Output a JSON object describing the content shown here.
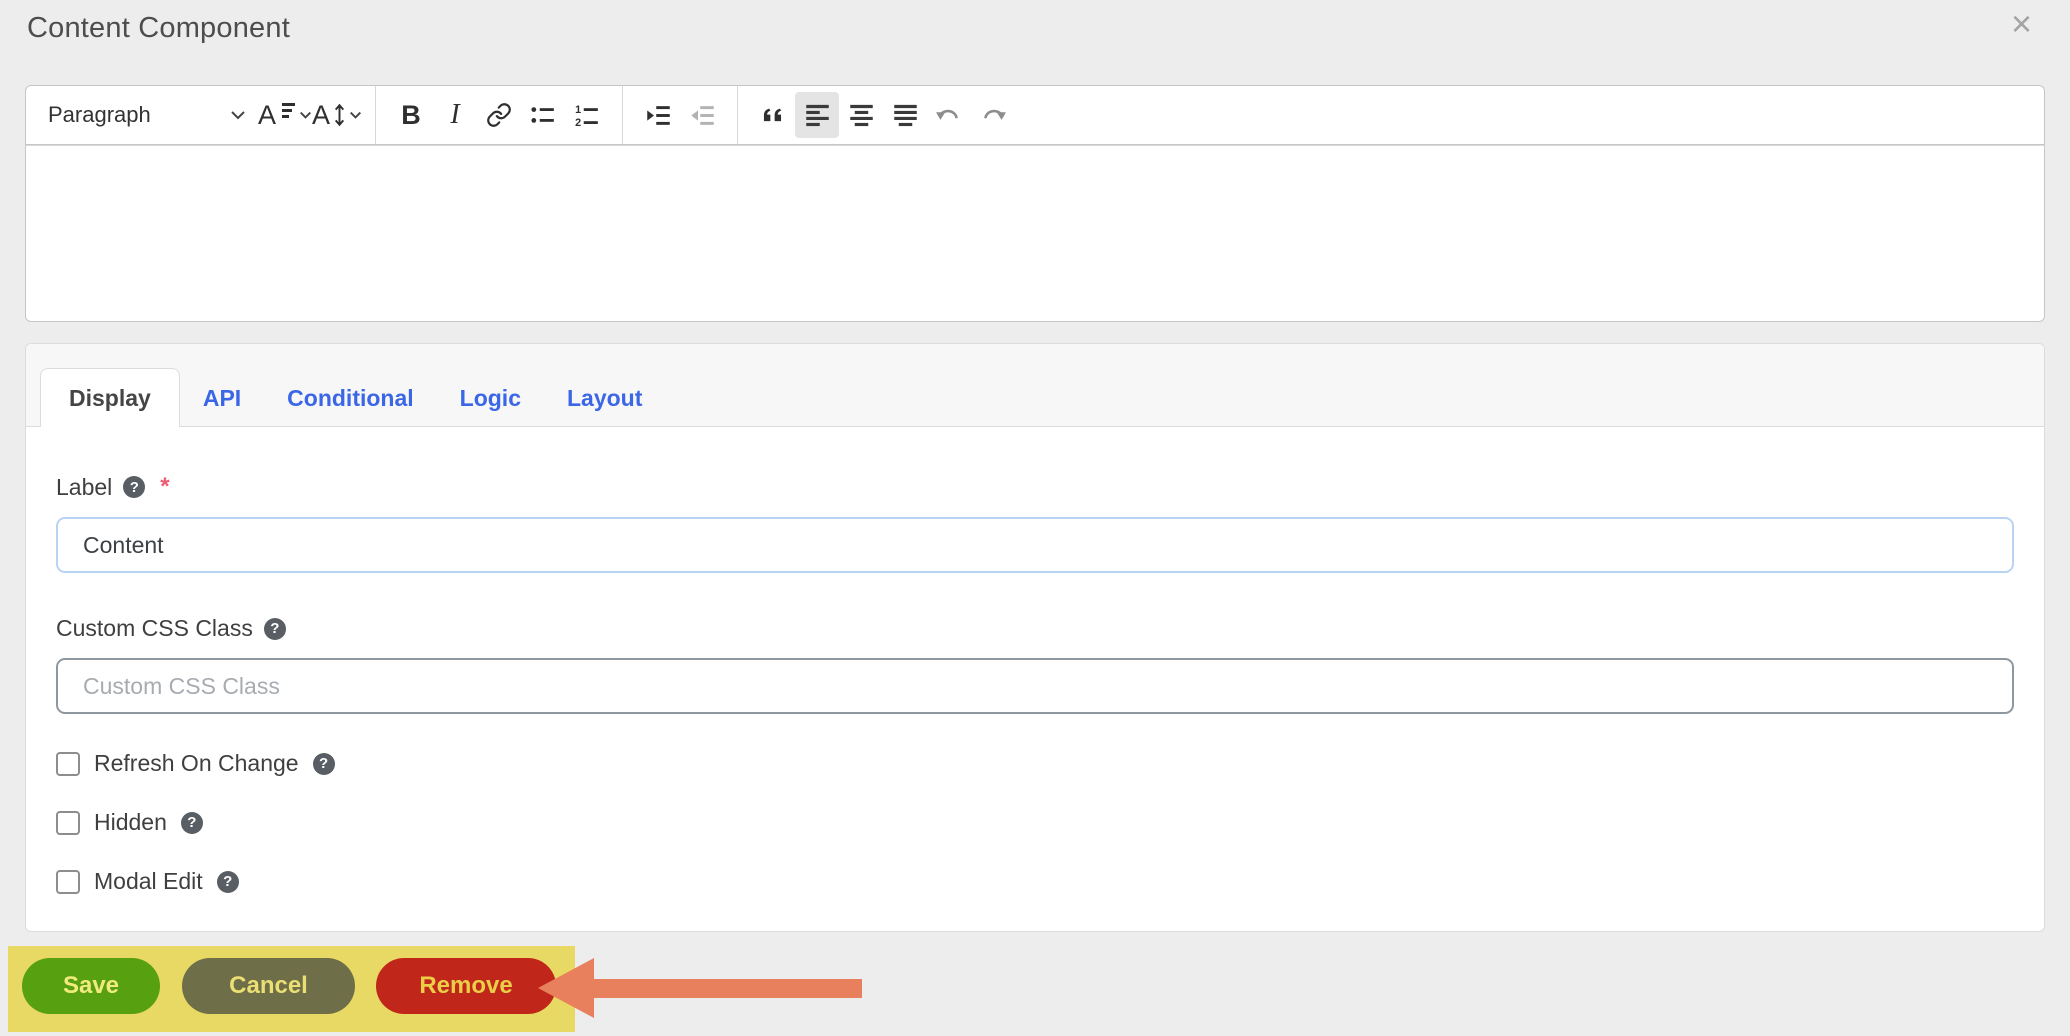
{
  "modal": {
    "title": "Content Component",
    "close_glyph": "×"
  },
  "editor": {
    "toolbar": {
      "heading_label": "Paragraph",
      "icons": [
        "heading-dropdown",
        "font-size",
        "font-family",
        "bold",
        "italic",
        "link",
        "bulleted-list",
        "numbered-list",
        "indent",
        "outdent",
        "block-quote",
        "align-left",
        "align-center",
        "align-justify",
        "undo",
        "redo"
      ],
      "active_button": "align-left",
      "disabled_buttons": [
        "outdent",
        "undo",
        "redo"
      ],
      "bold_glyph": "B",
      "italic_glyph": "I",
      "font_glyph": "A"
    },
    "content": ""
  },
  "tabs": {
    "items": [
      {
        "label": "Display",
        "active": true
      },
      {
        "label": "API",
        "active": false
      },
      {
        "label": "Conditional",
        "active": false
      },
      {
        "label": "Logic",
        "active": false
      },
      {
        "label": "Layout",
        "active": false
      }
    ]
  },
  "form": {
    "help_glyph": "?",
    "label_field": {
      "label": "Label",
      "required_marker": "*",
      "value": "Content"
    },
    "css_field": {
      "label": "Custom CSS Class",
      "placeholder": "Custom CSS Class",
      "value": ""
    },
    "checkboxes": [
      {
        "label": "Refresh On Change",
        "checked": false
      },
      {
        "label": "Hidden",
        "checked": false
      },
      {
        "label": "Modal Edit",
        "checked": false
      }
    ]
  },
  "actions": {
    "save": "Save",
    "cancel": "Cancel",
    "remove": "Remove"
  },
  "annotations": {
    "highlight_color": "#e8d965",
    "arrow_color": "#e9805d",
    "arrow_points_to": "Remove"
  },
  "colors": {
    "page_bg": "#ededed",
    "tab_link": "#3b66e6",
    "save_bg": "#57a00f",
    "cancel_bg": "#6e6e49",
    "remove_bg": "#c1261a",
    "input_focus_border": "#b9d4f2",
    "input_border": "#8f979f"
  }
}
